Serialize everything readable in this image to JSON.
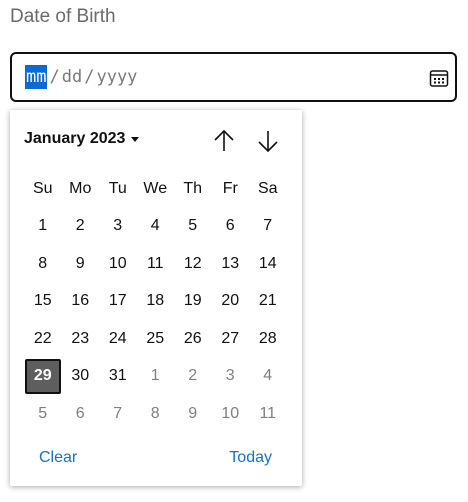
{
  "label": "Date of Birth",
  "input": {
    "month": "mm",
    "sep1": "/",
    "day": "dd",
    "sep2": "/",
    "year": "yyyy"
  },
  "calendar": {
    "month_year": "January 2023",
    "weekdays": [
      "Su",
      "Mo",
      "Tu",
      "We",
      "Th",
      "Fr",
      "Sa"
    ],
    "weeks": [
      [
        {
          "d": "1",
          "m": false
        },
        {
          "d": "2",
          "m": false
        },
        {
          "d": "3",
          "m": false
        },
        {
          "d": "4",
          "m": false
        },
        {
          "d": "5",
          "m": false
        },
        {
          "d": "6",
          "m": false
        },
        {
          "d": "7",
          "m": false
        }
      ],
      [
        {
          "d": "8",
          "m": false
        },
        {
          "d": "9",
          "m": false
        },
        {
          "d": "10",
          "m": false
        },
        {
          "d": "11",
          "m": false
        },
        {
          "d": "12",
          "m": false
        },
        {
          "d": "13",
          "m": false
        },
        {
          "d": "14",
          "m": false
        }
      ],
      [
        {
          "d": "15",
          "m": false
        },
        {
          "d": "16",
          "m": false
        },
        {
          "d": "17",
          "m": false
        },
        {
          "d": "18",
          "m": false
        },
        {
          "d": "19",
          "m": false
        },
        {
          "d": "20",
          "m": false
        },
        {
          "d": "21",
          "m": false
        }
      ],
      [
        {
          "d": "22",
          "m": false
        },
        {
          "d": "23",
          "m": false
        },
        {
          "d": "24",
          "m": false
        },
        {
          "d": "25",
          "m": false
        },
        {
          "d": "26",
          "m": false
        },
        {
          "d": "27",
          "m": false
        },
        {
          "d": "28",
          "m": false
        }
      ],
      [
        {
          "d": "29",
          "m": false,
          "sel": true
        },
        {
          "d": "30",
          "m": false
        },
        {
          "d": "31",
          "m": false
        },
        {
          "d": "1",
          "m": true
        },
        {
          "d": "2",
          "m": true
        },
        {
          "d": "3",
          "m": true
        },
        {
          "d": "4",
          "m": true
        }
      ],
      [
        {
          "d": "5",
          "m": true
        },
        {
          "d": "6",
          "m": true
        },
        {
          "d": "7",
          "m": true
        },
        {
          "d": "8",
          "m": true
        },
        {
          "d": "9",
          "m": true
        },
        {
          "d": "10",
          "m": true
        },
        {
          "d": "11",
          "m": true
        }
      ]
    ],
    "clear_label": "Clear",
    "today_label": "Today"
  },
  "icons": {
    "calendar": "calendar-icon",
    "up": "arrow-up-icon",
    "down": "arrow-down-icon"
  },
  "colors": {
    "accent": "#0a6bd3",
    "link": "#1b6fc4",
    "selected_bg": "#5e5e5e"
  }
}
